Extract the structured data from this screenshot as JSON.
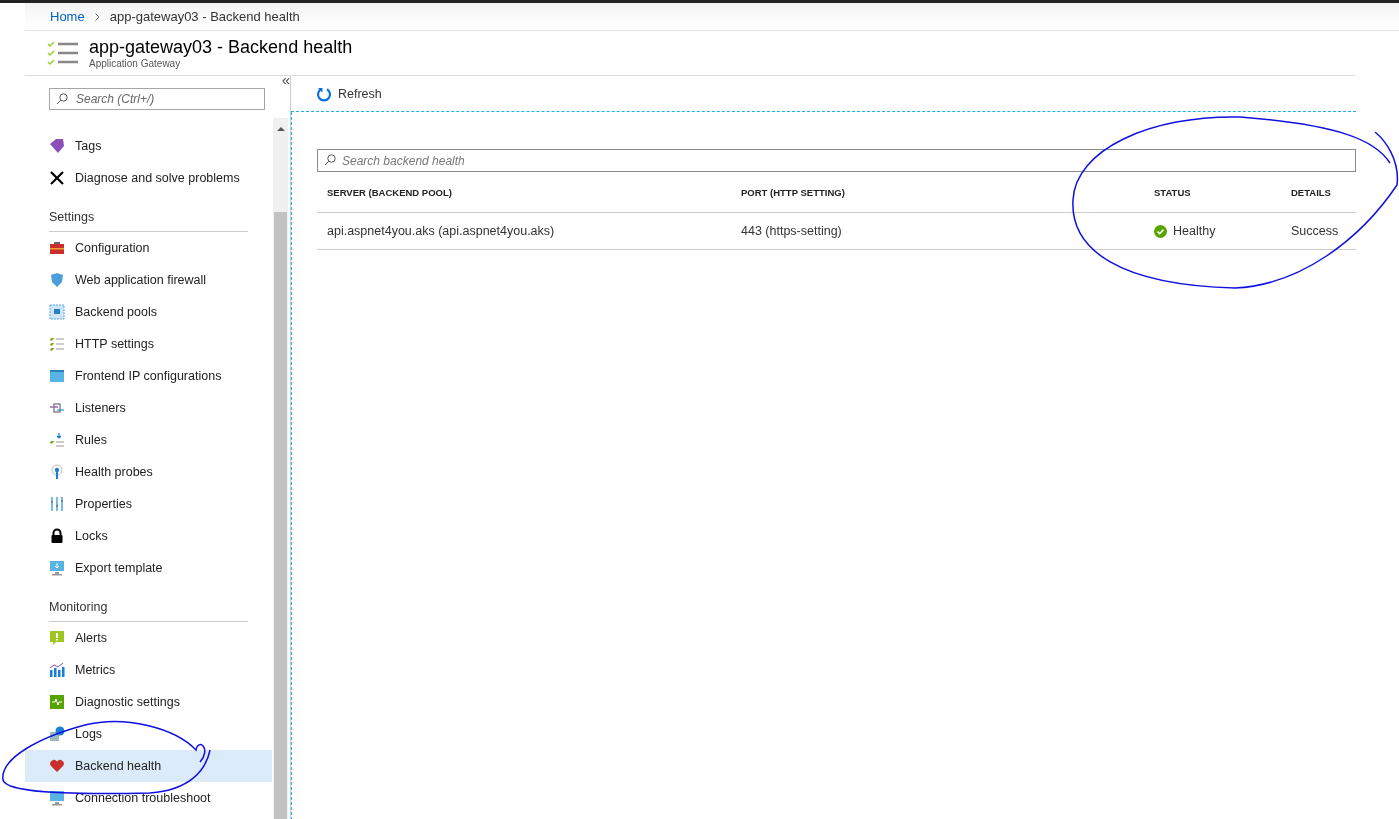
{
  "breadcrumb": {
    "items": [
      "Home",
      "app-gateway03 - Backend health"
    ]
  },
  "header": {
    "title": "app-gateway03 - Backend health",
    "subtitle": "Application Gateway"
  },
  "sidebar": {
    "search": {
      "placeholder": "Search (Ctrl+/)"
    },
    "collapse": "«",
    "sections": [
      {
        "items": [
          {
            "label": "Tags",
            "selected": false
          },
          {
            "label": "Diagnose and solve problems",
            "selected": false
          }
        ]
      },
      {
        "heading": "Settings",
        "items": [
          {
            "label": "Configuration",
            "selected": false
          },
          {
            "label": "Web application firewall",
            "selected": false
          },
          {
            "label": "Backend pools",
            "selected": false
          },
          {
            "label": "HTTP settings",
            "selected": false
          },
          {
            "label": "Frontend IP configurations",
            "selected": false
          },
          {
            "label": "Listeners",
            "selected": false
          },
          {
            "label": "Rules",
            "selected": false
          },
          {
            "label": "Health probes",
            "selected": false
          },
          {
            "label": "Properties",
            "selected": false
          },
          {
            "label": "Locks",
            "selected": false
          },
          {
            "label": "Export template",
            "selected": false
          }
        ]
      },
      {
        "heading": "Monitoring",
        "items": [
          {
            "label": "Alerts",
            "selected": false
          },
          {
            "label": "Metrics",
            "selected": false
          },
          {
            "label": "Diagnostic settings",
            "selected": false
          },
          {
            "label": "Logs",
            "selected": false
          },
          {
            "label": "Backend health",
            "selected": true
          },
          {
            "label": "Connection troubleshoot",
            "selected": false
          }
        ]
      }
    ]
  },
  "toolbar": {
    "refresh": "Refresh"
  },
  "search": {
    "placeholder": "Search backend health"
  },
  "table": {
    "columns": [
      "SERVER (BACKEND POOL)",
      "PORT (HTTP SETTING)",
      "STATUS",
      "DETAILS"
    ],
    "rows": [
      {
        "server": "api.aspnet4you.aks (api.aspnet4you.aks)",
        "port": "443 (https-setting)",
        "status": "Healthy",
        "healthy": true,
        "details": "Success"
      }
    ]
  }
}
